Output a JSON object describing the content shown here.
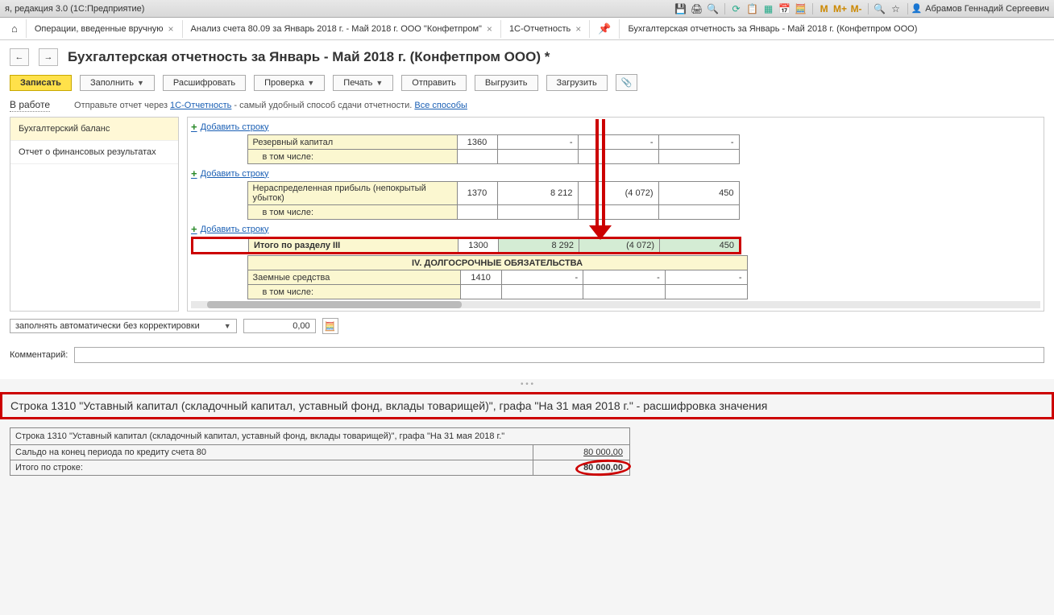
{
  "titlebar": {
    "app": "я, редакция 3.0  (1С:Предприятие)",
    "user": "Абрамов Геннадий Сергеевич"
  },
  "toolbar_icons": {
    "m": "M",
    "mplus": "M+",
    "mminus": "M-"
  },
  "tabs": {
    "t1": "Операции, введенные вручную",
    "t2": "Анализ счета 80.09 за Январь 2018 г. - Май 2018 г. ООО \"Конфетпром\"",
    "t3": "1С-Отчетность",
    "t4": "Бухгалтерская отчетность за Январь - Май 2018 г. (Конфетпром ООО)"
  },
  "page_title": "Бухгалтерская отчетность за Январь - Май 2018 г. (Конфетпром ООО) *",
  "buttons": {
    "save": "Записать",
    "fill": "Заполнить",
    "decode": "Расшифровать",
    "check": "Проверка",
    "print": "Печать",
    "send": "Отправить",
    "upload": "Выгрузить",
    "download": "Загрузить"
  },
  "status": "В работе",
  "hint": {
    "pre": "Отправьте отчет через ",
    "link1": "1С-Отчетность",
    "mid": " - самый удобный способ сдачи отчетности. ",
    "link2": "Все способы"
  },
  "side": {
    "i1": "Бухгалтерский баланс",
    "i2": "Отчет о финансовых результатах"
  },
  "addrow": "Добавить строку",
  "rows": {
    "r1": {
      "label": "Резервный капитал",
      "code": "1360",
      "c1": "-",
      "c2": "-",
      "c3": "-"
    },
    "r1b": {
      "label": "в том числе:"
    },
    "r2": {
      "label": "Нераспределенная прибыль (непокрытый убыток)",
      "code": "1370",
      "c1": "8 212",
      "c2": "(4 072)",
      "c3": "450"
    },
    "r2b": {
      "label": "в том числе:"
    },
    "r3": {
      "label": "Итого по разделу III",
      "code": "1300",
      "c1": "8 292",
      "c2": "(4 072)",
      "c3": "450"
    },
    "r4": {
      "label": "IV. ДОЛГОСРОЧНЫЕ ОБЯЗАТЕЛЬСТВА"
    },
    "r5": {
      "label": "Заемные средства",
      "code": "1410",
      "c1": "-",
      "c2": "-",
      "c3": "-"
    },
    "r5b": {
      "label": "в том числе:"
    }
  },
  "footer": {
    "mode": "заполнять автоматически без корректировки",
    "value": "0,00",
    "comment_label": "Комментарий:"
  },
  "section2_title": "Строка 1310 \"Уставный капитал (складочный капитал, уставный фонд, вклады товарищей)\", графа \"На 31 мая 2018 г.\" - расшифровка значения",
  "detail": {
    "header": "Строка 1310 \"Уставный капитал (складочный капитал, уставный фонд, вклады товарищей)\", графа \"На 31 мая 2018 г.\"",
    "row1": {
      "label": "Сальдо на конец периода по кредиту счета 80",
      "value": "80 000,00"
    },
    "row2": {
      "label": "Итого по строке:",
      "value": "80 000,00"
    }
  }
}
